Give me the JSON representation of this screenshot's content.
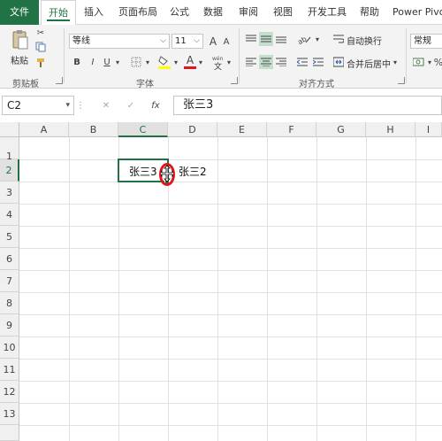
{
  "ribbon_tabs": [
    "文件",
    "开始",
    "插入",
    "页面布局",
    "公式",
    "数据",
    "审阅",
    "视图",
    "开发工具",
    "帮助",
    "Power Pivot"
  ],
  "clipboard": {
    "paste_label": "粘贴",
    "group_label": "剪贴板"
  },
  "font": {
    "name": "等线",
    "size": "11",
    "group_label": "字体",
    "bold": "B",
    "italic": "I",
    "underline": "U",
    "grow": "A",
    "shrink": "A",
    "font_color": "A"
  },
  "alignment": {
    "wrap_text": "自动换行",
    "merge_center": "合并后居中",
    "group_label": "对齐方式"
  },
  "number": {
    "format": "常规"
  },
  "formula_bar": {
    "name_box": "C2",
    "cancel": "✕",
    "enter": "✓",
    "fx": "fx",
    "value": "张三3"
  },
  "grid": {
    "columns": [
      "A",
      "B",
      "C",
      "D",
      "E",
      "F",
      "G",
      "H",
      "I"
    ],
    "rows": [
      "1",
      "2",
      "3",
      "4",
      "5",
      "6",
      "7",
      "8",
      "9",
      "10",
      "11",
      "12",
      "13"
    ],
    "selected_column": "C",
    "selected_row": "2",
    "cells": {
      "C2": "张三3",
      "D2": "张三2"
    }
  },
  "colors": {
    "accent": "#217346",
    "marker": "#e0161b"
  }
}
